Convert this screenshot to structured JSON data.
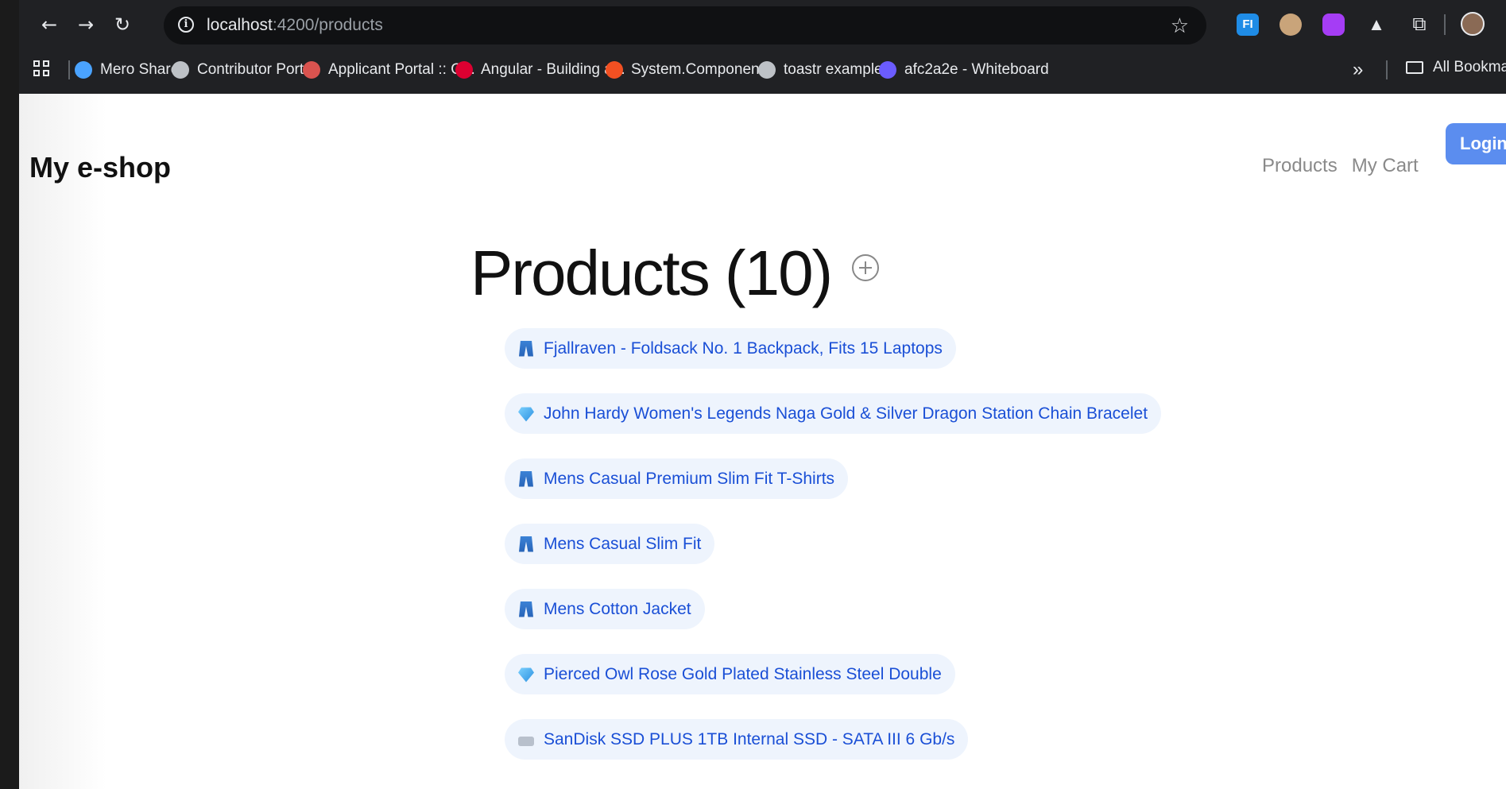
{
  "browser": {
    "url_host": "localhost",
    "url_path": ":4200/products",
    "bookmarks": [
      {
        "label": "Mero Share",
        "icon": "meroshare-icon",
        "color": "#4aa3ff"
      },
      {
        "label": "Contributor Portal",
        "icon": "globe-icon",
        "color": "#bdc1c6"
      },
      {
        "label": "Applicant Portal :: O...",
        "icon": "applicant-portal-icon",
        "color": "#d9534f"
      },
      {
        "label": "Angular - Building a...",
        "icon": "angular-icon",
        "color": "#dd0031"
      },
      {
        "label": "System.Component...",
        "icon": "microsoft-icon",
        "color": "#f25022"
      },
      {
        "label": "toastr examples",
        "icon": "globe-icon",
        "color": "#bdc1c6"
      },
      {
        "label": "afc2a2e - Whiteboard",
        "icon": "whiteboard-icon",
        "color": "#6b5cff"
      }
    ],
    "all_bookmarks_label": "All Bookma"
  },
  "header": {
    "brand": "My e-shop",
    "nav": [
      "Products",
      "My Cart"
    ],
    "login_label": "Login"
  },
  "main": {
    "title": "Products (10)",
    "products": [
      {
        "name": "Fjallraven - Foldsack No. 1 Backpack, Fits 15 Laptops",
        "icon": "jeans-icon"
      },
      {
        "name": "John Hardy Women's Legends Naga Gold & Silver Dragon Station Chain Bracelet",
        "icon": "gem-icon"
      },
      {
        "name": "Mens Casual Premium Slim Fit T-Shirts",
        "icon": "jeans-icon"
      },
      {
        "name": "Mens Casual Slim Fit",
        "icon": "jeans-icon"
      },
      {
        "name": "Mens Cotton Jacket",
        "icon": "jeans-icon"
      },
      {
        "name": "Pierced Owl Rose Gold Plated Stainless Steel Double",
        "icon": "gem-icon"
      },
      {
        "name": "SanDisk SSD PLUS 1TB Internal SSD - SATA III 6 Gb/s",
        "icon": "keyboard-icon"
      }
    ]
  }
}
